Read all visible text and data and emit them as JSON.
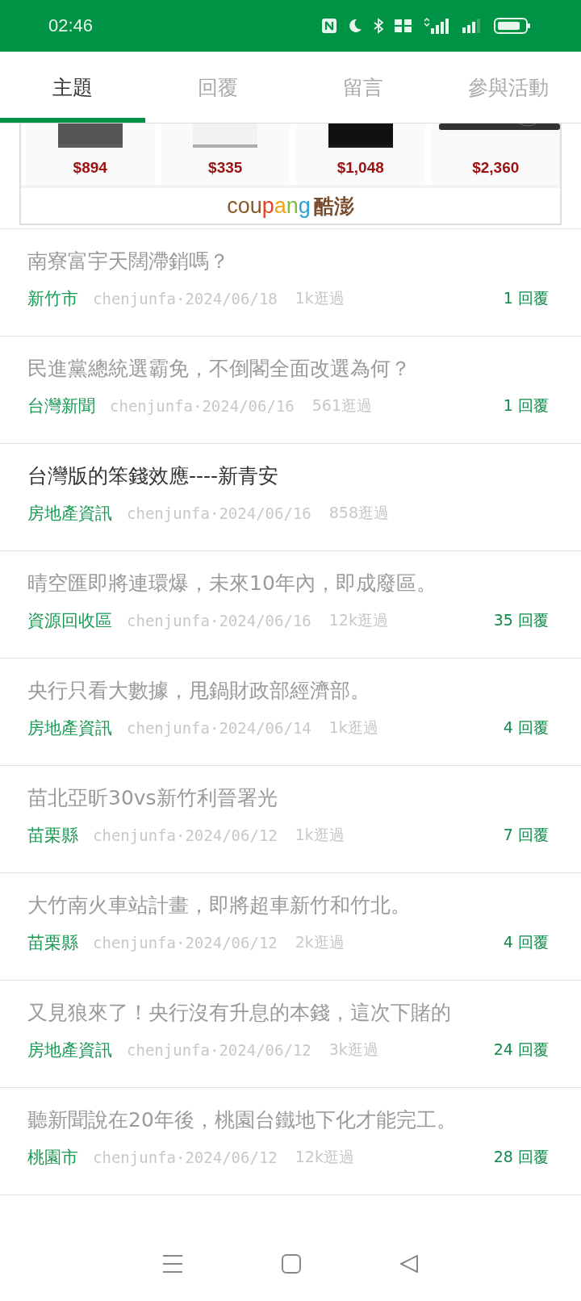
{
  "status_bar": {
    "time": "02:46"
  },
  "tabs": [
    {
      "label": "主題",
      "selected": true
    },
    {
      "label": "回覆",
      "selected": false
    },
    {
      "label": "留言",
      "selected": false
    },
    {
      "label": "參與活動",
      "selected": false
    }
  ],
  "ad": {
    "products": [
      {
        "price": "$894",
        "kind": "picture"
      },
      {
        "price": "$335",
        "kind": "picture"
      },
      {
        "price": "$1,048",
        "kind": "picture"
      },
      {
        "price": "$2,360",
        "kind": "picture"
      }
    ],
    "brand": "coupang",
    "brand_local": "酷澎"
  },
  "topics": [
    {
      "title": "南寮富宇天闊滯銷嗎？",
      "read": true,
      "category": "新竹市",
      "author_date": "chenjunfa·2024/06/18",
      "views": "1k逛過",
      "replies": "1 回覆"
    },
    {
      "title": "民進黨總統選霸免，不倒閣全面改選為何？",
      "read": true,
      "category": "台灣新聞",
      "author_date": "chenjunfa·2024/06/16",
      "views": "561逛過",
      "replies": "1 回覆"
    },
    {
      "title": "台灣版的笨錢效應----新青安",
      "read": false,
      "category": "房地產資訊",
      "author_date": "chenjunfa·2024/06/16",
      "views": "858逛過"
    },
    {
      "title": "晴空匯即將連環爆，未來10年內，即成廢區。",
      "read": true,
      "category": "資源回收區",
      "author_date": "chenjunfa·2024/06/16",
      "views": "12k逛過",
      "replies": "35 回覆"
    },
    {
      "title": "央行只看大數據，甩鍋財政部經濟部。",
      "read": true,
      "category": "房地產資訊",
      "author_date": "chenjunfa·2024/06/14",
      "views": "1k逛過",
      "replies": "4 回覆"
    },
    {
      "title": "苗北亞昕30vs新竹利晉署光",
      "read": true,
      "category": "苗栗縣",
      "author_date": "chenjunfa·2024/06/12",
      "views": "1k逛過",
      "replies": "7 回覆"
    },
    {
      "title": "大竹南火車站計畫，即將超車新竹和竹北。",
      "read": true,
      "category": "苗栗縣",
      "author_date": "chenjunfa·2024/06/12",
      "views": "2k逛過",
      "replies": "4 回覆"
    },
    {
      "title": "又見狼來了！央行沒有升息的本錢，這次下賭的",
      "read": true,
      "category": "房地產資訊",
      "author_date": "chenjunfa·2024/06/12",
      "views": "3k逛過",
      "replies": "24 回覆"
    },
    {
      "title": "聽新聞說在20年後，桃園台鐵地下化才能完工。",
      "read": true,
      "category": "桃園市",
      "author_date": "chenjunfa·2024/06/12",
      "views": "12k逛過",
      "replies": "28 回覆"
    }
  ]
}
